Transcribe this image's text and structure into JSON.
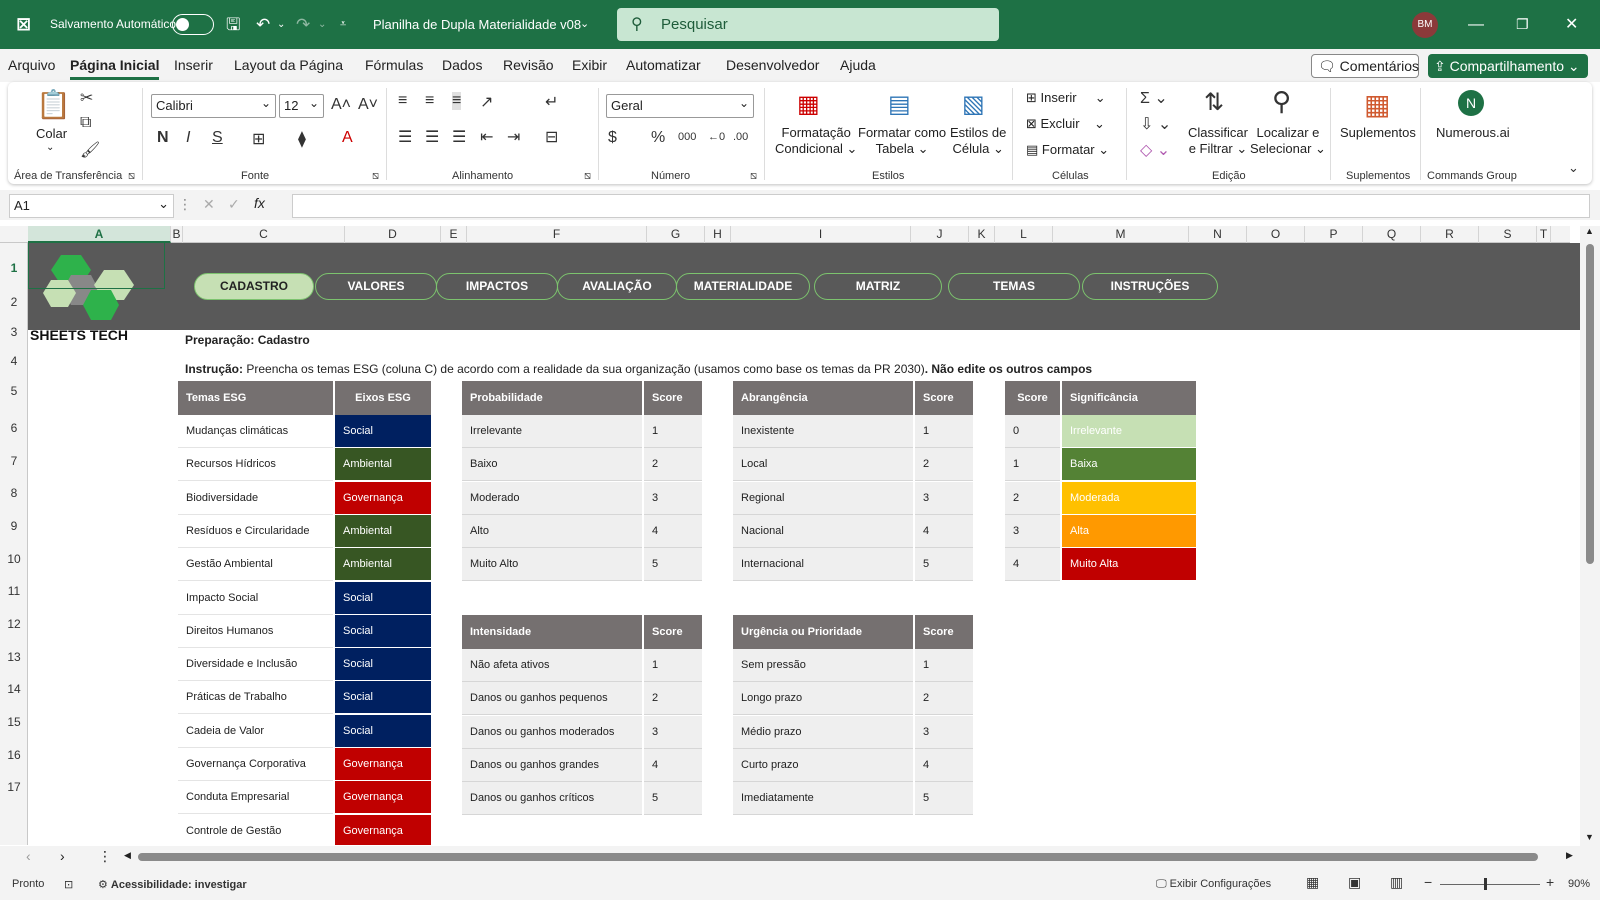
{
  "titlebar": {
    "autosave_label": "Salvamento Automático",
    "doc_title": "Planilha de Dupla Materialidade v08",
    "search_placeholder": "Pesquisar",
    "user_initials": "BM"
  },
  "menu": {
    "items": [
      "Arquivo",
      "Página Inicial",
      "Inserir",
      "Layout da Página",
      "Fórmulas",
      "Dados",
      "Revisão",
      "Exibir",
      "Automatizar",
      "Desenvolvedor",
      "Ajuda"
    ],
    "active": "Página Inicial",
    "comments": "Comentários",
    "share": "Compartilhamento"
  },
  "ribbon": {
    "paste": "Colar",
    "font_name": "Calibri",
    "font_size": "12",
    "number_format": "Geral",
    "bold": "N",
    "italic": "I",
    "underline": "S",
    "cond_format": [
      "Formatação",
      "Condicional"
    ],
    "format_table": [
      "Formatar como",
      "Tabela"
    ],
    "cell_styles": [
      "Estilos de",
      "Célula"
    ],
    "insert": "Inserir",
    "delete": "Excluir",
    "format": "Formatar",
    "sort_filter": [
      "Classificar",
      "e Filtrar"
    ],
    "find_select": [
      "Localizar e",
      "Selecionar"
    ],
    "addins": "Suplementos",
    "numerous": "Numerous.ai",
    "groups": {
      "clipboard": "Área de Transferência",
      "font": "Fonte",
      "alignment": "Alinhamento",
      "number": "Número",
      "styles": "Estilos",
      "cells": "Células",
      "editing": "Edição",
      "addins": "Suplementos",
      "commands": "Commands Group"
    }
  },
  "formula_bar": {
    "name_box": "A1",
    "fx": "fx",
    "value": ""
  },
  "columns": [
    "A",
    "B",
    "C",
    "D",
    "E",
    "F",
    "G",
    "H",
    "I",
    "J",
    "K",
    "L",
    "M",
    "N",
    "O",
    "P",
    "Q",
    "R",
    "S",
    "T"
  ],
  "rows": [
    "1",
    "2",
    "3",
    "4",
    "5",
    "6",
    "7",
    "8",
    "9",
    "10",
    "11",
    "12",
    "13",
    "14",
    "15",
    "16",
    "17"
  ],
  "sheet": {
    "logo_text": "SHEETS TECH",
    "nav": [
      "CADASTRO",
      "VALORES",
      "IMPACTOS",
      "AVALIAÇÃO",
      "MATERIALIDADE",
      "MATRIZ",
      "TEMAS",
      "INSTRUÇÕES"
    ],
    "active_nav": "CADASTRO",
    "prep_title": "Preparação: Cadastro",
    "instr_label": "Instrução:",
    "instr_text": " Preencha os temas ESG (coluna C) de acordo com a realidade da sua organização (usamos como base os temas da PR 2030)",
    "instr_bold": ". Não edite os outros campos",
    "themes": {
      "headers": [
        "Temas ESG",
        "Eixos ESG"
      ],
      "rows": [
        [
          "Mudanças climáticas",
          "Social"
        ],
        [
          "Recursos Hídricos",
          "Ambiental"
        ],
        [
          "Biodiversidade",
          "Governança"
        ],
        [
          "Resíduos e Circularidade",
          "Ambiental"
        ],
        [
          "Gestão Ambiental",
          "Ambiental"
        ],
        [
          "Impacto Social",
          "Social"
        ],
        [
          "Direitos Humanos",
          "Social"
        ],
        [
          "Diversidade e Inclusão",
          "Social"
        ],
        [
          "Práticas de Trabalho",
          "Social"
        ],
        [
          "Cadeia de Valor",
          "Social"
        ],
        [
          "Governança Corporativa",
          "Governança"
        ],
        [
          "Conduta Empresarial",
          "Governança"
        ],
        [
          "Controle de Gestão",
          "Governança"
        ]
      ]
    },
    "axis_colors": {
      "Social": "#002060",
      "Ambiental": "#375623",
      "Governança": "#c00000"
    },
    "probabilidade": {
      "headers": [
        "Probabilidade",
        "Score"
      ],
      "rows": [
        [
          "Irrelevante",
          "1"
        ],
        [
          "Baixo",
          "2"
        ],
        [
          "Moderado",
          "3"
        ],
        [
          "Alto",
          "4"
        ],
        [
          "Muito Alto",
          "5"
        ]
      ]
    },
    "abrangencia": {
      "headers": [
        "Abrangência",
        "Score"
      ],
      "rows": [
        [
          "Inexistente",
          "1"
        ],
        [
          "Local",
          "2"
        ],
        [
          "Regional",
          "3"
        ],
        [
          "Nacional",
          "4"
        ],
        [
          "Internacional",
          "5"
        ]
      ]
    },
    "significancia": {
      "headers": [
        "Score",
        "Significância"
      ],
      "rows": [
        [
          "0",
          "Irrelevante",
          "#c6e0b4"
        ],
        [
          "1",
          "Baixa",
          "#548235"
        ],
        [
          "2",
          "Moderada",
          "#ffc000"
        ],
        [
          "3",
          "Alta",
          "#ff9900"
        ],
        [
          "4",
          "Muito Alta",
          "#c00000"
        ]
      ]
    },
    "intensidade": {
      "headers": [
        "Intensidade",
        "Score"
      ],
      "rows": [
        [
          "Não afeta ativos",
          "1"
        ],
        [
          "Danos ou ganhos pequenos",
          "2"
        ],
        [
          "Danos ou ganhos moderados",
          "3"
        ],
        [
          "Danos ou ganhos grandes",
          "4"
        ],
        [
          "Danos ou ganhos críticos",
          "5"
        ]
      ]
    },
    "urgencia": {
      "headers": [
        "Urgência ou Prioridade",
        "Score"
      ],
      "rows": [
        [
          "Sem pressão",
          "1"
        ],
        [
          "Longo prazo",
          "2"
        ],
        [
          "Médio prazo",
          "3"
        ],
        [
          "Curto prazo",
          "4"
        ],
        [
          "Imediatamente",
          "5"
        ]
      ]
    }
  },
  "status": {
    "ready": "Pronto",
    "accessibility": "Acessibilidade: investigar",
    "display_settings": "Exibir Configurações",
    "zoom": "90%"
  }
}
